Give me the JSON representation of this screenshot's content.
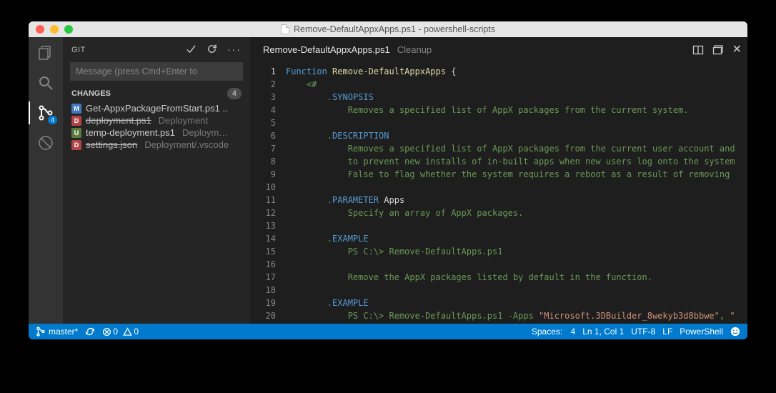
{
  "window": {
    "title": "Remove-DefaultAppxApps.ps1 - powershell-scripts"
  },
  "scm": {
    "panel_title": "GIT",
    "commit_placeholder": "Message (press Cmd+Enter to",
    "section": "CHANGES",
    "count": "4",
    "changes": [
      {
        "status": "M",
        "name": "Get-AppxPackageFromStart.ps1 ..",
        "path": "",
        "deleted": false
      },
      {
        "status": "D",
        "name": "deployment.ps1",
        "path": "Deployment",
        "deleted": true
      },
      {
        "status": "U",
        "name": "temp-deployment.ps1",
        "path": "Deploym…",
        "deleted": false
      },
      {
        "status": "D",
        "name": "settings.json",
        "path": "Deployment/.vscode",
        "deleted": true
      }
    ]
  },
  "activity": {
    "scm_badge": "4"
  },
  "tab": {
    "name": "Remove-DefaultAppxApps.ps1",
    "state": "Cleanup"
  },
  "code": {
    "lines": [
      {
        "n": "1",
        "html": "<span class='kw'>Function</span> <span class='fn'>Remove-DefaultAppxApps</span> {"
      },
      {
        "n": "2",
        "html": "    <span class='cm'>&lt;#</span>"
      },
      {
        "n": "3",
        "html": "        <span class='cm'>.</span><span class='sy'>SYNOPSIS</span>"
      },
      {
        "n": "4",
        "html": "            <span class='cm'>Removes a specified list of AppX packages from the current system.</span>"
      },
      {
        "n": "5",
        "html": ""
      },
      {
        "n": "6",
        "html": "        <span class='cm'>.</span><span class='sy'>DESCRIPTION</span>"
      },
      {
        "n": "7",
        "html": "            <span class='cm'>Removes a specified list of AppX packages from the current user account and</span>"
      },
      {
        "n": "8",
        "html": "            <span class='cm'>to prevent new installs of in-built apps when new users log onto the system</span>"
      },
      {
        "n": "9",
        "html": "            <span class='cm'>False to flag whether the system requires a reboot as a result of removing </span>"
      },
      {
        "n": "10",
        "html": ""
      },
      {
        "n": "11",
        "html": "        <span class='cm'>.</span><span class='sy'>PARAMETER</span> <span class='dir'>Apps</span>"
      },
      {
        "n": "12",
        "html": "            <span class='cm'>Specify an array of AppX packages.</span>"
      },
      {
        "n": "13",
        "html": ""
      },
      {
        "n": "14",
        "html": "        <span class='cm'>.</span><span class='sy'>EXAMPLE</span>"
      },
      {
        "n": "15",
        "html": "            <span class='cm'>PS C:\\&gt; Remove-DefaultApps.ps1</span>"
      },
      {
        "n": "16",
        "html": ""
      },
      {
        "n": "17",
        "html": "            <span class='cm'>Remove the AppX packages listed by default in the function.</span>"
      },
      {
        "n": "18",
        "html": ""
      },
      {
        "n": "19",
        "html": "        <span class='cm'>.</span><span class='sy'>EXAMPLE</span>"
      },
      {
        "n": "20",
        "html": "            <span class='cm'>PS C:\\&gt; Remove-DefaultApps.ps1 -Apps </span><span class='str'>\"Microsoft.3DBuilder_8wekyb3d8bbwe\"</span><span class='cm'>, </span><span class='str'>\"</span>"
      }
    ]
  },
  "status": {
    "branch": "master*",
    "errors": "0",
    "warnings": "0",
    "spaces_label": "Spaces:",
    "spaces": "4",
    "cursor": "Ln 1, Col 1",
    "encoding": "UTF-8",
    "eol": "LF",
    "lang": "PowerShell"
  }
}
